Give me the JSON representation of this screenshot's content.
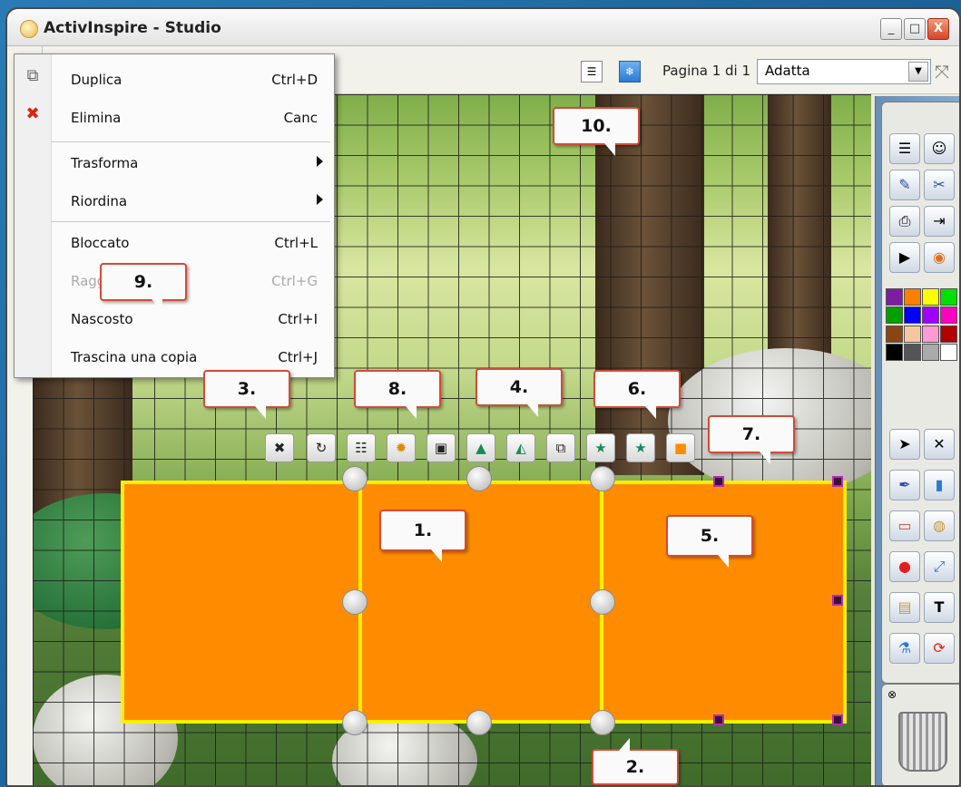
{
  "window": {
    "title": "ActivInspire - Studio",
    "min": "_",
    "max": "□",
    "close": "X"
  },
  "toolbar": {
    "page_label": "Pagina 1 di 1",
    "zoom_value": "Adatta"
  },
  "menu": {
    "items": [
      {
        "label": "Duplica",
        "shortcut": "Ctrl+D"
      },
      {
        "label": "Elimina",
        "shortcut": "Canc"
      },
      {
        "label": "Trasforma",
        "shortcut": ""
      },
      {
        "label": "Riordina",
        "shortcut": ""
      },
      {
        "label": "Bloccato",
        "shortcut": "Ctrl+L"
      },
      {
        "label": "Ragg",
        "shortcut": "Ctrl+G"
      },
      {
        "label": "Nascosto",
        "shortcut": "Ctrl+I"
      },
      {
        "label": "Trascina una copia",
        "shortcut": "Ctrl+J"
      }
    ]
  },
  "callouts": {
    "c1": "1.",
    "c2": "2.",
    "c3": "3.",
    "c4": "4.",
    "c5": "5.",
    "c6": "6.",
    "c7": "7.",
    "c8": "8.",
    "c9": "9.",
    "c10": "10."
  },
  "colors": {
    "accent": "#ff8c00",
    "border": "#ffef00",
    "callout_border": "#d24b36"
  },
  "palette": [
    "#7a1fa2",
    "#ff7f00",
    "#ffff00",
    "#00e000",
    "#00a000",
    "#0000ff",
    "#a000ff",
    "#ff00c0",
    "#8b4513",
    "#f5c7a0",
    "#ff9ad5",
    "#b00000",
    "#000000",
    "#555555",
    "#aaaaaa",
    "#ffffff"
  ]
}
